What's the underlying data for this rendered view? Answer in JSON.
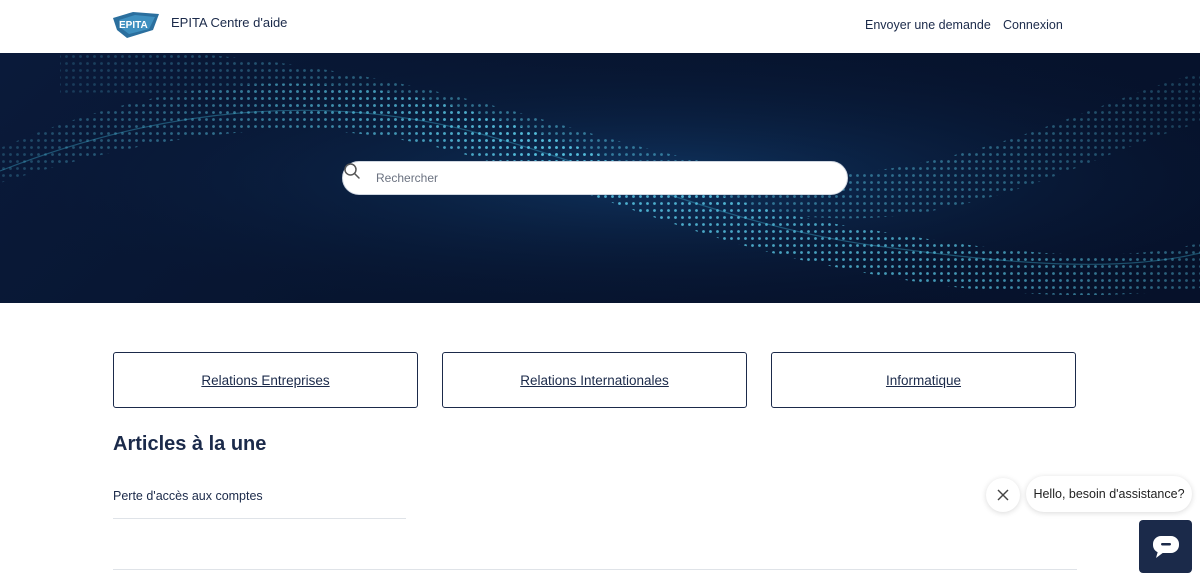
{
  "header": {
    "brand": "EPITA Centre d'aide",
    "logo_text": "EPITA",
    "nav": {
      "request": "Envoyer une demande",
      "login": "Connexion"
    }
  },
  "hero": {
    "search_placeholder": "Rechercher"
  },
  "categories": [
    {
      "label": "Relations Entreprises"
    },
    {
      "label": "Relations Internationales"
    },
    {
      "label": "Informatique"
    }
  ],
  "promoted": {
    "title": "Articles à la une",
    "articles": [
      {
        "title": "Perte d'accès aux comptes"
      }
    ]
  },
  "chat": {
    "greeting": "Hello, besoin d'assistance?",
    "close_icon": "close-icon",
    "launcher_icon": "chat-icon"
  },
  "colors": {
    "primary": "#1b2a4a",
    "hero_bg": "#071530",
    "hero_accent": "#3fc4e8"
  }
}
